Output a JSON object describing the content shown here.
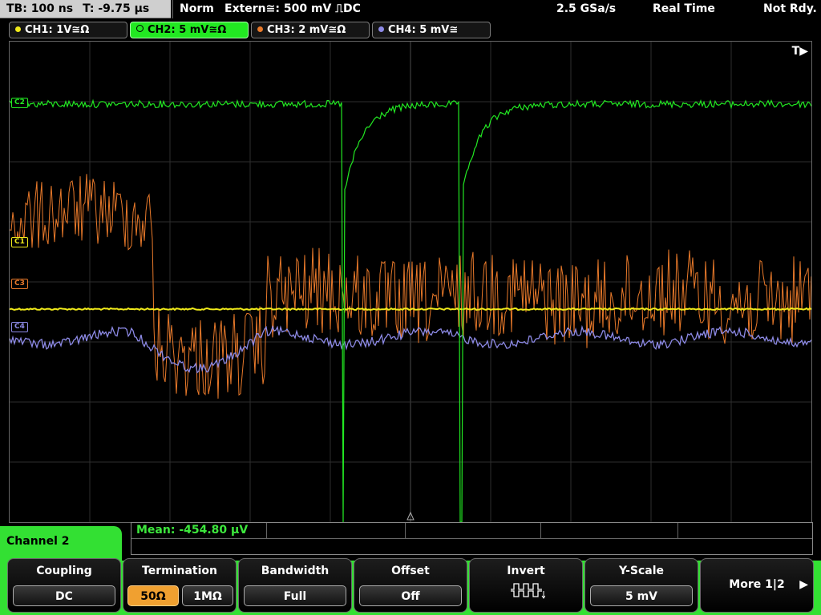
{
  "topbar": {
    "timebase": "TB: 100 ns",
    "trigger_time": "T: -9.75 µs",
    "mode": "Norm",
    "trigger_source": "Extern≅: 500 mV ⎍DC",
    "sample_rate": "2.5 GSa/s",
    "acq_mode": "Real Time",
    "status": "Not Rdy."
  },
  "channels": [
    {
      "label": "CH1: 1V≅Ω",
      "color": "#f0ea1a"
    },
    {
      "label": "CH2: 5 mV≅Ω",
      "color": "#22e822"
    },
    {
      "label": "CH3: 2 mV≅Ω",
      "color": "#e8792a"
    },
    {
      "label": "CH4: 5 mV≅",
      "color": "#8d8ae6"
    }
  ],
  "screen": {
    "trigger_marker": "T▶",
    "ch_markers": [
      "C2",
      "C1",
      "C3",
      "C4"
    ]
  },
  "measurement": {
    "mean": "Mean: -454.80 µV"
  },
  "panel": {
    "channel_label": "Channel 2",
    "coupling_title": "Coupling",
    "coupling_value": "DC",
    "termination_title": "Termination",
    "term_50": "50Ω",
    "term_1m": "1MΩ",
    "bandwidth_title": "Bandwidth",
    "bandwidth_value": "Full",
    "offset_title": "Offset",
    "offset_value": "Off",
    "invert_title": "Invert",
    "yscale_title": "Y-Scale",
    "yscale_value": "5 mV",
    "more_label": "More 1|2",
    "more_arrow": "▶"
  }
}
